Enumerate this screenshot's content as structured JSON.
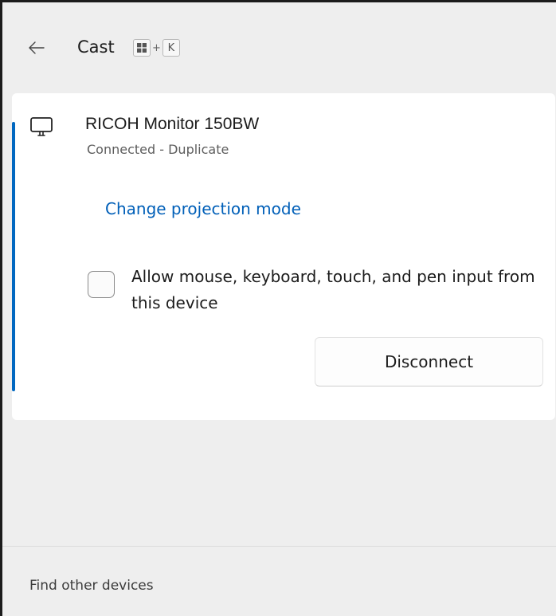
{
  "header": {
    "back_icon": "arrow-left-icon",
    "title": "Cast",
    "shortcut": {
      "win_key_icon": "windows-logo-icon",
      "plus": "+",
      "key": "K"
    }
  },
  "device": {
    "icon": "monitor-icon",
    "name": "RICOH Monitor 150BW",
    "status": "Connected - Duplicate",
    "projection_link": "Change projection mode",
    "input_checkbox": {
      "label": "Allow mouse, keyboard, touch, and pen input from this device",
      "checked": false
    },
    "disconnect_label": "Disconnect"
  },
  "footer": {
    "find_devices_label": "Find other devices"
  },
  "colors": {
    "accent": "#0067c0",
    "link": "#005fb8",
    "background": "#eeeeee",
    "card": "#ffffff"
  }
}
